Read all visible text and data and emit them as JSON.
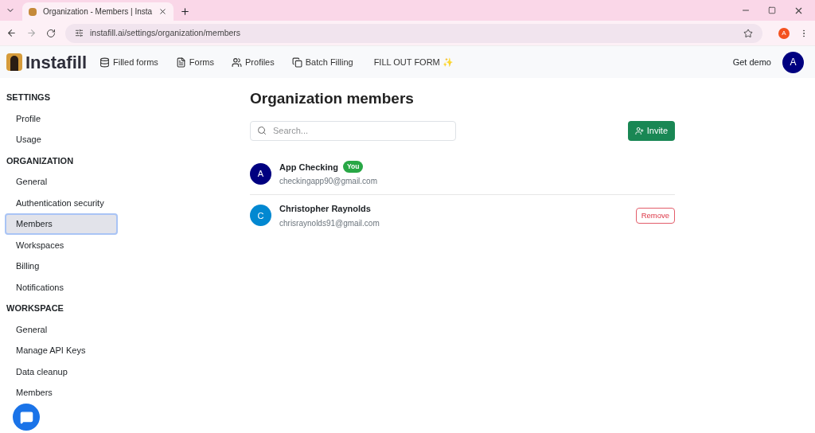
{
  "browser": {
    "tab_title": "Organization - Members | Insta",
    "url": "instafill.ai/settings/organization/members",
    "profile_initial": "A"
  },
  "header": {
    "logo": "Instafill",
    "nav": [
      {
        "kind": "db",
        "label": "Filled forms"
      },
      {
        "kind": "doc",
        "label": "Forms"
      },
      {
        "kind": "users",
        "label": "Profiles"
      },
      {
        "kind": "copy",
        "label": "Batch Filling"
      },
      {
        "kind": "cta",
        "label": "FILL OUT FORM ✨"
      }
    ],
    "demo": "Get demo",
    "avatar": "A"
  },
  "sidebar": [
    {
      "title": "SETTINGS",
      "items": [
        {
          "label": "Profile",
          "selected": false
        },
        {
          "label": "Usage",
          "selected": false
        }
      ]
    },
    {
      "title": "ORGANIZATION",
      "items": [
        {
          "label": "General",
          "selected": false
        },
        {
          "label": "Authentication security",
          "selected": false
        },
        {
          "label": "Members",
          "selected": true
        },
        {
          "label": "Workspaces",
          "selected": false
        },
        {
          "label": "Billing",
          "selected": false
        },
        {
          "label": "Notifications",
          "selected": false
        }
      ]
    },
    {
      "title": "WORKSPACE",
      "items": [
        {
          "label": "General",
          "selected": false
        },
        {
          "label": "Manage API Keys",
          "selected": false
        },
        {
          "label": "Data cleanup",
          "selected": false
        },
        {
          "label": "Members",
          "selected": false
        }
      ]
    }
  ],
  "page": {
    "title": "Organization members",
    "search_placeholder": "Search...",
    "invite": "Invite"
  },
  "members": [
    {
      "initial": "A",
      "color": "#000080",
      "name": "App Checking",
      "badge": "You",
      "email": "checkingapp90@gmail.com"
    },
    {
      "initial": "C",
      "color": "#0288d1",
      "name": "Christopher Raynolds",
      "email": "chrisraynolds91@gmail.com",
      "action": "Remove"
    }
  ]
}
